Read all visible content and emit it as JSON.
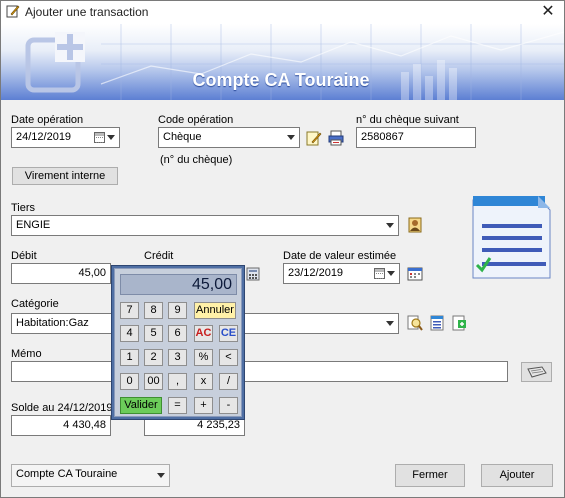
{
  "window": {
    "title": "Ajouter une transaction",
    "close_glyph": "✕"
  },
  "banner": {
    "title": "Compte CA Touraine"
  },
  "fields": {
    "date_operation": {
      "label": "Date opération",
      "value": "24/12/2019"
    },
    "code_operation": {
      "label": "Code opération",
      "value": "Chèque",
      "hint": "(n° du chèque)"
    },
    "numero_cheque": {
      "label": "n° du chèque suivant",
      "value": "2580867"
    },
    "tiers": {
      "label": "Tiers",
      "value": "ENGIE"
    },
    "debit": {
      "label": "Débit",
      "value": "45,00"
    },
    "credit": {
      "label": "Crédit",
      "value": ""
    },
    "date_valeur": {
      "label": "Date de valeur estimée",
      "value": "23/12/2019"
    },
    "categorie": {
      "label": "Catégorie",
      "value": "Habitation:Gaz"
    },
    "memo": {
      "label": "Mémo",
      "value": ""
    },
    "solde": {
      "label": "Solde au 24/12/2019",
      "value": "4 430,48"
    },
    "solde_projete": {
      "value": "4 235,23"
    }
  },
  "buttons": {
    "virement_interne": "Virement interne",
    "fermer": "Fermer",
    "ajouter": "Ajouter"
  },
  "account_select": {
    "value": "Compte CA Touraine"
  },
  "calculator": {
    "display": "45,00",
    "keys": {
      "k7": "7",
      "k8": "8",
      "k9": "9",
      "annuler": "Annuler",
      "k4": "4",
      "k5": "5",
      "k6": "6",
      "ac": "AC",
      "ce": "CE",
      "k1": "1",
      "k2": "2",
      "k3": "3",
      "percent": "%",
      "back": "<",
      "k0": "0",
      "k00": "00",
      "comma": ",",
      "mul": "x",
      "div": "/",
      "valider": "Valider",
      "eq": "=",
      "plus": "+",
      "minus": "-"
    }
  },
  "colors": {
    "banner_blue": "#5c7fd3",
    "calc_frame": "#4f6fa4",
    "valider_green": "#6ccc5a",
    "annuler_yellow": "#fff1a8",
    "ac_red": "#c81e1e",
    "ce_blue": "#2a4fc9"
  },
  "icons": {
    "title": "edit-pencil-icon",
    "banner": "add-document-icon",
    "code_edit": "edit-note-icon",
    "code_print": "print-cheque-icon",
    "tiers_person": "contact-card-icon",
    "date_calendar": "calendar-icon",
    "categorie_search": "search-document-icon",
    "categorie_list": "category-list-icon",
    "categorie_add": "add-category-icon",
    "memo_keyboard": "keyboard-icon",
    "illustration": "checklist-document-icon"
  }
}
